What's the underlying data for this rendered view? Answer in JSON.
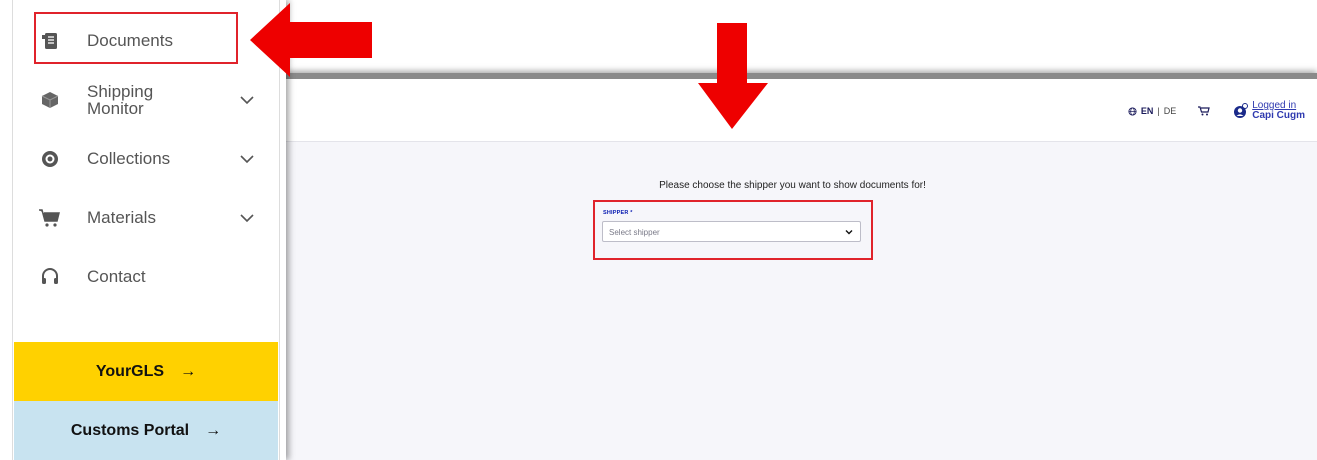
{
  "sidebar": {
    "items": [
      {
        "label": "Documents",
        "icon": "document-icon"
      },
      {
        "label_line1": "Shipping",
        "label_line2": "Monitor",
        "icon": "box-icon"
      },
      {
        "label": "Collections",
        "icon": "collections-icon"
      },
      {
        "label": "Materials",
        "icon": "cart-icon"
      },
      {
        "label": "Contact",
        "icon": "headset-icon"
      }
    ],
    "yourgls_label": "YourGLS",
    "customs_label": "Customs Portal",
    "arrow": "→"
  },
  "header": {
    "lang_active": "EN",
    "lang_sep": "|",
    "lang_other": "DE",
    "login_line1": "Logged in",
    "login_line2": "Capi Cugm"
  },
  "main": {
    "prompt": "Please choose the shipper you want to show documents for!",
    "shipper_label": "SHIPPER *",
    "shipper_placeholder": "Select shipper"
  },
  "colors": {
    "accent_red": "#e0232b",
    "gls_yellow": "#ffd100",
    "gls_blue": "#061ab1",
    "customs_blue": "#c8e3f0"
  }
}
